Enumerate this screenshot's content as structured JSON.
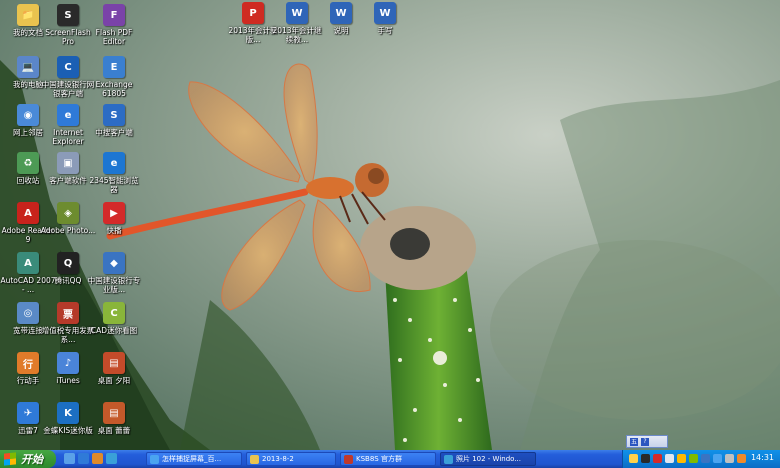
{
  "desktop": {
    "icons": [
      {
        "label": "我的文档",
        "glyph": "📁",
        "color": "#e9c34f"
      },
      {
        "label": "ScreenFlash Pro",
        "glyph": "S",
        "color": "#2a2a2a"
      },
      {
        "label": "Flash PDF Editor",
        "glyph": "F",
        "color": "#7a43a8"
      },
      {
        "label": "我的电脑",
        "glyph": "💻",
        "color": "#5b86c9"
      },
      {
        "label": "中国建设银行网银客户端",
        "glyph": "C",
        "color": "#1b5fb4"
      },
      {
        "label": "Exchange 61805",
        "glyph": "E",
        "color": "#3a7fd0"
      },
      {
        "label": "网上邻居",
        "glyph": "◉",
        "color": "#4a8ad8"
      },
      {
        "label": "Internet Explorer",
        "glyph": "e",
        "color": "#2f7ad8"
      },
      {
        "label": "中搜客户端",
        "glyph": "S",
        "color": "#2c6cc4"
      },
      {
        "label": "回收站",
        "glyph": "♻",
        "color": "#4d9a55"
      },
      {
        "label": "客户端软件",
        "glyph": "▣",
        "color": "#8b9bb8"
      },
      {
        "label": "2345智能浏览器",
        "glyph": "e",
        "color": "#1d76d2"
      },
      {
        "label": "Adobe Reader 9",
        "glyph": "A",
        "color": "#c8231c"
      },
      {
        "label": "Adobe Photo...",
        "glyph": "◈",
        "color": "#6d8c2f"
      },
      {
        "label": "快播",
        "glyph": "▶",
        "color": "#d42a2a"
      },
      {
        "label": "AutoCAD 2007 - ...",
        "glyph": "A",
        "color": "#3a8b7a"
      },
      {
        "label": "腾讯QQ",
        "glyph": "Q",
        "color": "#222222"
      },
      {
        "label": "中国建设银行专业版...",
        "glyph": "◆",
        "color": "#3a74c2"
      },
      {
        "label": "宽带连接",
        "glyph": "◎",
        "color": "#5a8ac6"
      },
      {
        "label": "增值税专用发票系...",
        "glyph": "票",
        "color": "#b53a2a"
      },
      {
        "label": "CAD迷你看图",
        "glyph": "C",
        "color": "#89b53a"
      },
      {
        "label": "行动手",
        "glyph": "行",
        "color": "#e07b2a"
      },
      {
        "label": "iTunes",
        "glyph": "♪",
        "color": "#4a84d8"
      },
      {
        "label": "桌面 夕阳",
        "glyph": "▤",
        "color": "#c44b2a"
      },
      {
        "label": "迅雷7",
        "glyph": "✈",
        "color": "#2f7ad8"
      },
      {
        "label": "金蝶KIS迷你版",
        "glyph": "K",
        "color": "#1c6fc2"
      },
      {
        "label": "桌面 蕾蕾",
        "glyph": "▤",
        "color": "#c4592a"
      },
      {
        "label": "2013年会计新版...",
        "glyph": "P",
        "color": "#cf2b22"
      },
      {
        "label": "2013年会计继续教...",
        "glyph": "W",
        "color": "#2f65b8"
      },
      {
        "label": "说明",
        "glyph": "W",
        "color": "#2f65b8"
      },
      {
        "label": "手写",
        "glyph": "W",
        "color": "#2f65b8"
      }
    ]
  },
  "taskbar": {
    "start_label": "开始",
    "tasks": [
      {
        "label": "怎样捕捉屏幕_百...",
        "color": "#4aa4f0"
      },
      {
        "label": "2013-8-2",
        "color": "#e9c34f"
      },
      {
        "label": "KSB8S 官方群",
        "color": "#c0392b"
      },
      {
        "label": "照片 102 - Windo...",
        "color": "#3aa0d8"
      }
    ],
    "clock": "14:31",
    "lang_items": [
      "五",
      "?"
    ]
  },
  "colors": {
    "taskbar_blue": "#245edb",
    "start_green": "#3a9a38",
    "tray_blue": "#0d81d8"
  }
}
